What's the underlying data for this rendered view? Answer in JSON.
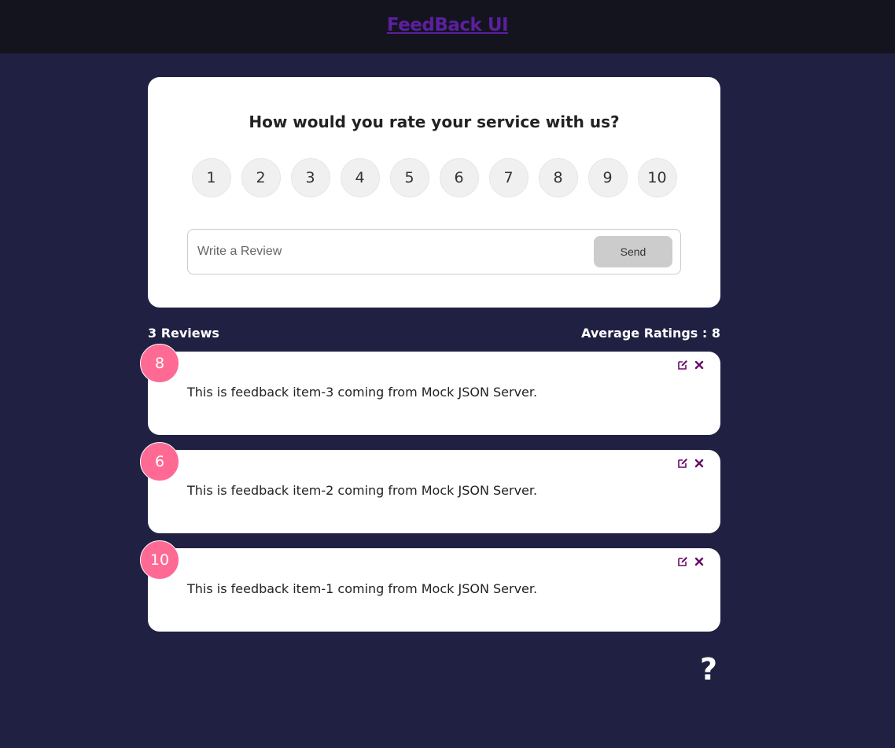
{
  "header": {
    "title": "FeedBack UI"
  },
  "form": {
    "title": "How would you rate your service with us?",
    "ratings": [
      "1",
      "2",
      "3",
      "4",
      "5",
      "6",
      "7",
      "8",
      "9",
      "10"
    ],
    "review_placeholder": "Write a Review",
    "review_value": "",
    "send_label": "Send"
  },
  "stats": {
    "count_label": "3 Reviews",
    "average_label": "Average Ratings : 8"
  },
  "feedback": [
    {
      "rating": "8",
      "text": "This is feedback item-3 coming from Mock JSON Server."
    },
    {
      "rating": "6",
      "text": "This is feedback item-2 coming from Mock JSON Server."
    },
    {
      "rating": "10",
      "text": "This is feedback item-1 coming from Mock JSON Server."
    }
  ],
  "help": {
    "label": "?"
  },
  "icons": {
    "edit": "edit-icon",
    "delete": "close-icon"
  },
  "colors": {
    "background": "#202142",
    "header": "#14141f",
    "brand": "#5c1f9e",
    "badge": "#ff6a95",
    "icon": "#6a0a6a",
    "send_button": "#cccccc"
  }
}
